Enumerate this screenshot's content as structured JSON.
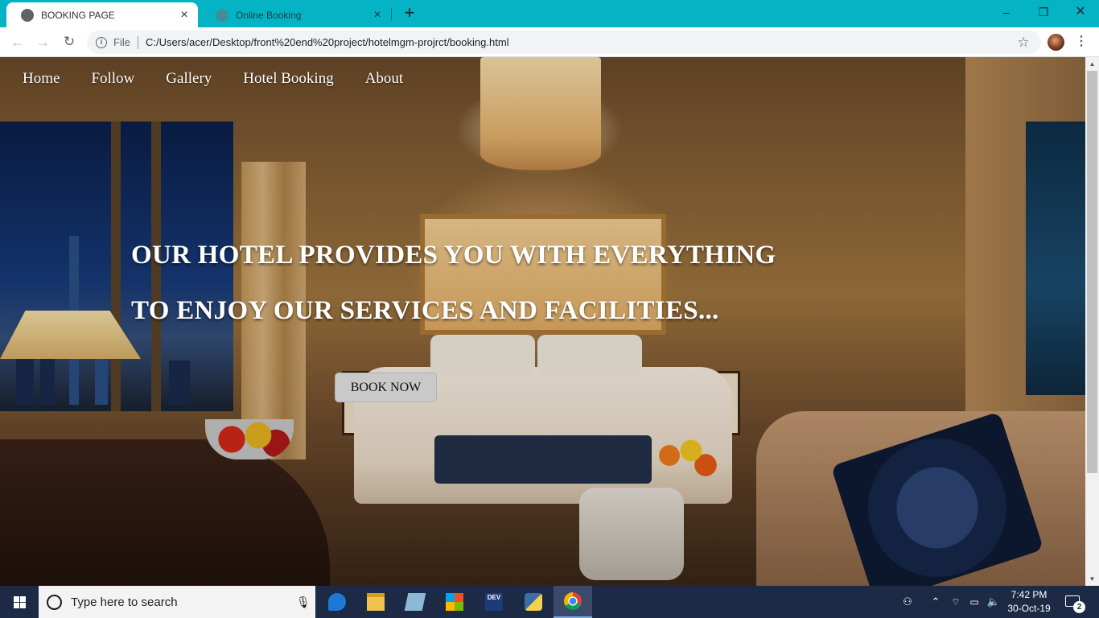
{
  "browser": {
    "tabs": [
      {
        "title": "BOOKING PAGE",
        "active": true
      },
      {
        "title": "Online Booking",
        "active": false
      }
    ],
    "new_tab_glyph": "+",
    "window_controls": {
      "minimize": "–",
      "maximize": "❐",
      "close": "✕"
    },
    "address_bar": {
      "scheme_label": "File",
      "url": "C:/Users/acer/Desktop/front%20end%20project/hotelmgm-projrct/booking.html"
    },
    "icons": [
      "back-arrow-icon",
      "forward-arrow-icon",
      "reload-icon",
      "info-icon",
      "bookmark-star-icon",
      "profile-avatar",
      "menu-kebab-icon"
    ]
  },
  "page": {
    "nav": [
      "Home",
      "Follow",
      "Gallery",
      "Hotel Booking",
      "About"
    ],
    "headline_line1": "OUR HOTEL PROVIDES YOU WITH EVERYTHING",
    "headline_line2": "TO ENJOY OUR SERVICES AND FACILITIES...",
    "cta_label": "BOOK NOW"
  },
  "taskbar": {
    "search_placeholder": "Type here to search",
    "pinned_apps": [
      "edge-icon",
      "file-explorer-icon",
      "notes-icon",
      "store-icon",
      "dev-cpp-icon",
      "python-idle-icon",
      "chrome-icon"
    ],
    "active_app": "chrome-icon",
    "clock_time": "7:42 PM",
    "clock_date": "30-Oct-19",
    "notification_count": "2",
    "dev_icon_text": "DEV"
  },
  "colors": {
    "tabstrip": "#04b4c4",
    "taskbar": "#1c2a45",
    "cta_background": "#c9c9c9",
    "headline_text": "#ffffff"
  }
}
